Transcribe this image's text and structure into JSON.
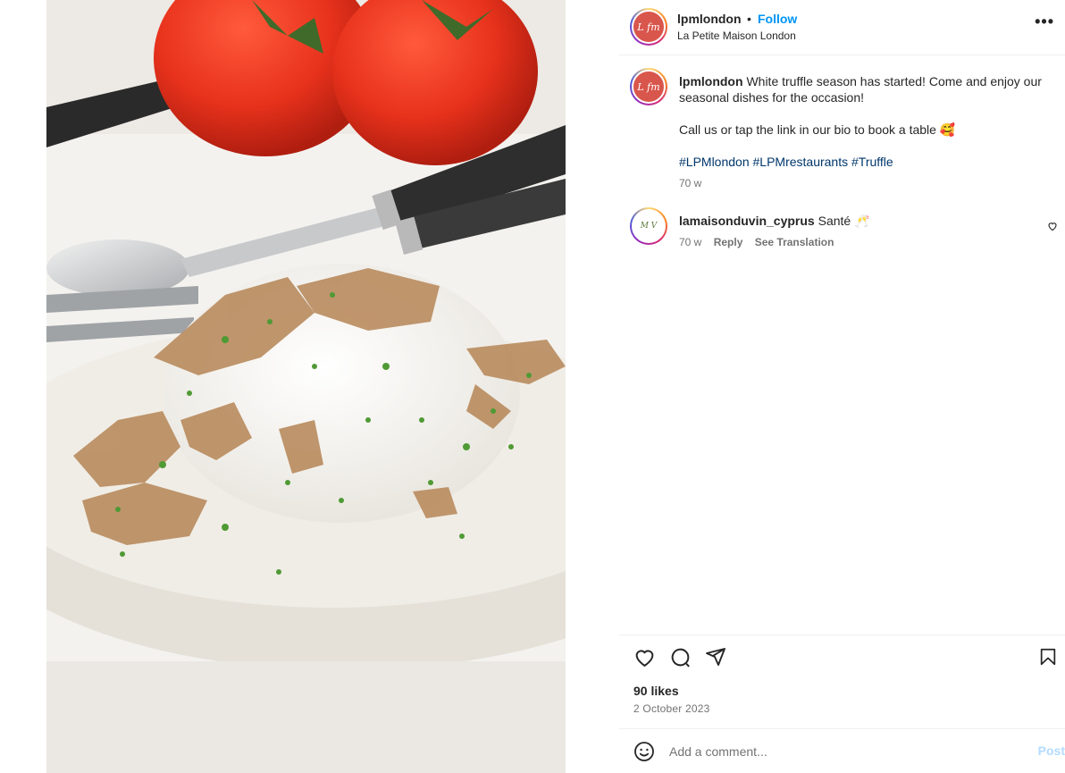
{
  "post": {
    "username": "lpmlondon",
    "follow_label": "Follow",
    "separator": "•",
    "location": "La Petite Maison London",
    "more_label": "•••",
    "avatar_logo": "L fm",
    "caption": {
      "line1": "White truffle season has started! Come and enjoy our seasonal dishes for the occasion!",
      "line2": "Call us or tap the link in our bio to book a table 🥰",
      "hashtags": "#LPMlondon #LPMrestaurants #Truffle",
      "time": "70 w"
    }
  },
  "comments": [
    {
      "username": "lamaisonduvin_cyprus",
      "avatar_logo": "M V",
      "text": "Santé 🥂",
      "time": "70 w",
      "reply_label": "Reply",
      "translate_label": "See Translation"
    }
  ],
  "engagement": {
    "likes": "90 likes",
    "date": "2 October 2023"
  },
  "comment_box": {
    "placeholder": "Add a comment...",
    "post_label": "Post"
  },
  "icons": {
    "more": "more-options-icon",
    "like": "heart-icon",
    "comment": "comment-bubble-icon",
    "share": "paper-plane-icon",
    "save": "bookmark-icon",
    "emoji": "emoji-smile-icon",
    "comment_like": "small-heart-icon"
  },
  "colors": {
    "accent": "#0095f6",
    "text": "#262626",
    "muted": "#737373",
    "hashtag": "#00376b",
    "post_disabled": "#b3dbff"
  }
}
